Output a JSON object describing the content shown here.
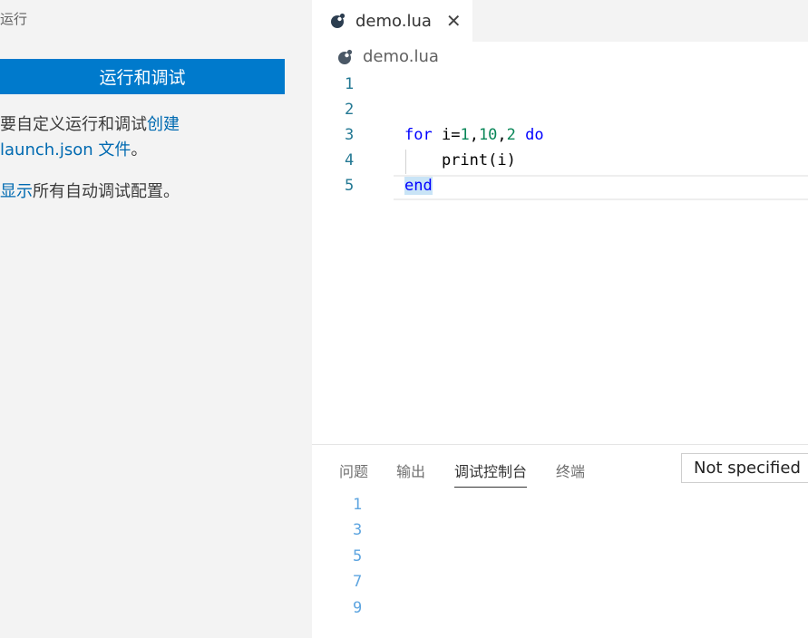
{
  "sidebar": {
    "header": "运行",
    "run_button_label": "运行和调试",
    "line1_prefix": "要自定义运行和调试",
    "line1_link": "创建",
    "line2_link": "launch.json 文件",
    "line2_suffix": "。",
    "line3_link": "显示",
    "line3_suffix": "所有自动调试配置。"
  },
  "editor": {
    "tab_label": "demo.lua",
    "breadcrumb": "demo.lua",
    "line_numbers": [
      "1",
      "2",
      "3",
      "4",
      "5"
    ],
    "code": {
      "for_kw": "for",
      "var_assign": " i=",
      "start": "1",
      "comma1": ",",
      "stop": "10",
      "comma2": ",",
      "step": "2",
      "do_kw": " do",
      "print_line": "    print(i)",
      "end_kw": "end"
    }
  },
  "panel": {
    "tabs": [
      "问题",
      "输出",
      "调试控制台",
      "终端"
    ],
    "active_tab": "调试控制台",
    "filter_value": "Not specified",
    "output_lines": [
      "1",
      "3",
      "5",
      "7",
      "9"
    ]
  },
  "colors": {
    "accent": "#007acc",
    "link": "#006ab1",
    "keyword": "#0000ff",
    "number": "#098658",
    "line_number": "#237893",
    "console_output": "#5ea5e0"
  }
}
